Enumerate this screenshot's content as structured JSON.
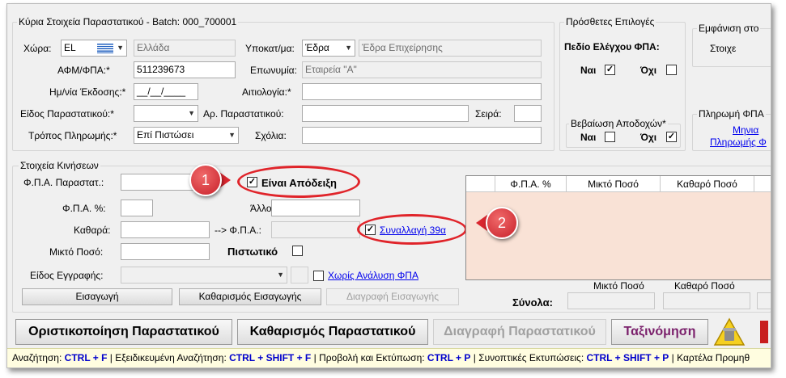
{
  "header": {
    "title": "Κύρια Στοιχεία Παραστατικού - Batch: 000_700001"
  },
  "main": {
    "country_label": "Χώρα:",
    "country_code": "EL",
    "country_name": "Ελλάδα",
    "branch_label": "Υποκατ/μα:",
    "branch_value": "Έδρα",
    "branch_name": "Έδρα Επιχείρησης",
    "vat_label": "ΑΦΜ/ΦΠΑ:*",
    "vat_value": "511239673",
    "company_label": "Επωνυμία:",
    "company_value": "Εταιρεία \"Α\"",
    "date_label": "Ημ/νία Έκδοσης:*",
    "date_value": "__/__/____",
    "reason_label": "Αιτιολογία:*",
    "doc_type_label": "Είδος Παραστατικού:*",
    "doc_number_label": "Αρ. Παραστατικού:",
    "series_label": "Σειρά:",
    "payment_label": "Τρόπος Πληρωμής:*",
    "payment_value": "Επί Πιστώσει",
    "comments_label": "Σχόλια:"
  },
  "extra": {
    "title": "Πρόσθετες Επιλογές",
    "vat_check_label": "Πεδίο Ελέγχου ΦΠΑ:",
    "yes": "Ναι",
    "no": "Όχι",
    "income_cert_label": "Βεβαίωση Αποδοχών*"
  },
  "right_panel": {
    "display_title": "Εμφάνιση στο",
    "display_item": "Στοιχε",
    "payment_title": "Πληρωμή ΦΠΑ",
    "payment_link1": "Μηνια",
    "payment_link2": "Πληρωμής Φ"
  },
  "movements": {
    "title": "Στοιχεία Κινήσεων",
    "vat_doc_label": "Φ.Π.Α. Παραστατ.:",
    "is_receipt_label": "Είναι Απόδειξη",
    "vat_pct_label": "Φ.Π.Α. %:",
    "other_label": "Άλλο:",
    "net_label": "Καθαρά:",
    "arrow_vat_label": "--> Φ.Π.Α.:",
    "transaction_39a_label": "Συναλλαγή 39α",
    "gross_label": "Μικτό Ποσό:",
    "credit_label": "Πιστωτικό",
    "entry_type_label": "Είδος Εγγραφής:",
    "no_vat_analysis_label": "Χωρίς Ανάλυση ΦΠΑ",
    "grid_headers": [
      "Φ.Π.Α. %",
      "Μικτό Ποσό",
      "Καθαρό Ποσό"
    ],
    "insert_btn": "Εισαγωγή",
    "clear_insert_btn": "Καθαρισμός Εισαγωγής",
    "delete_insert_btn": "Διαγραφή Εισαγωγής",
    "totals_label": "Σύνολα:",
    "totals_gross_label": "Μικτό Ποσό",
    "totals_net_label": "Καθαρό Ποσό"
  },
  "toolbar": {
    "finalize": "Οριστικοποίηση Παραστατικού",
    "clear_doc": "Καθαρισμός Παραστατικού",
    "delete_doc": "Διαγραφή Παραστατικού",
    "sort": "Ταξινόμηση"
  },
  "callouts": {
    "one": "1",
    "two": "2"
  },
  "status": {
    "search": "Αναζήτηση:",
    "search_key": "CTRL + F",
    "adv_search": "Εξειδικευμένη Αναζήτηση:",
    "adv_search_key": "CTRL + SHIFT + F",
    "print": "Προβολή και Εκτύπωση:",
    "print_key": "CTRL + P",
    "reports": "Συνοπτικές Εκτυπώσεις:",
    "reports_key": "CTRL + SHIFT + P",
    "card": "Καρτέλα Προμηθ"
  },
  "colors": {
    "grid_bg": "#f9e2d6",
    "callout": "#d9262f",
    "link": "#0000ee",
    "sort_text": "#7a1f6b",
    "status_bg": "#fffde0"
  }
}
